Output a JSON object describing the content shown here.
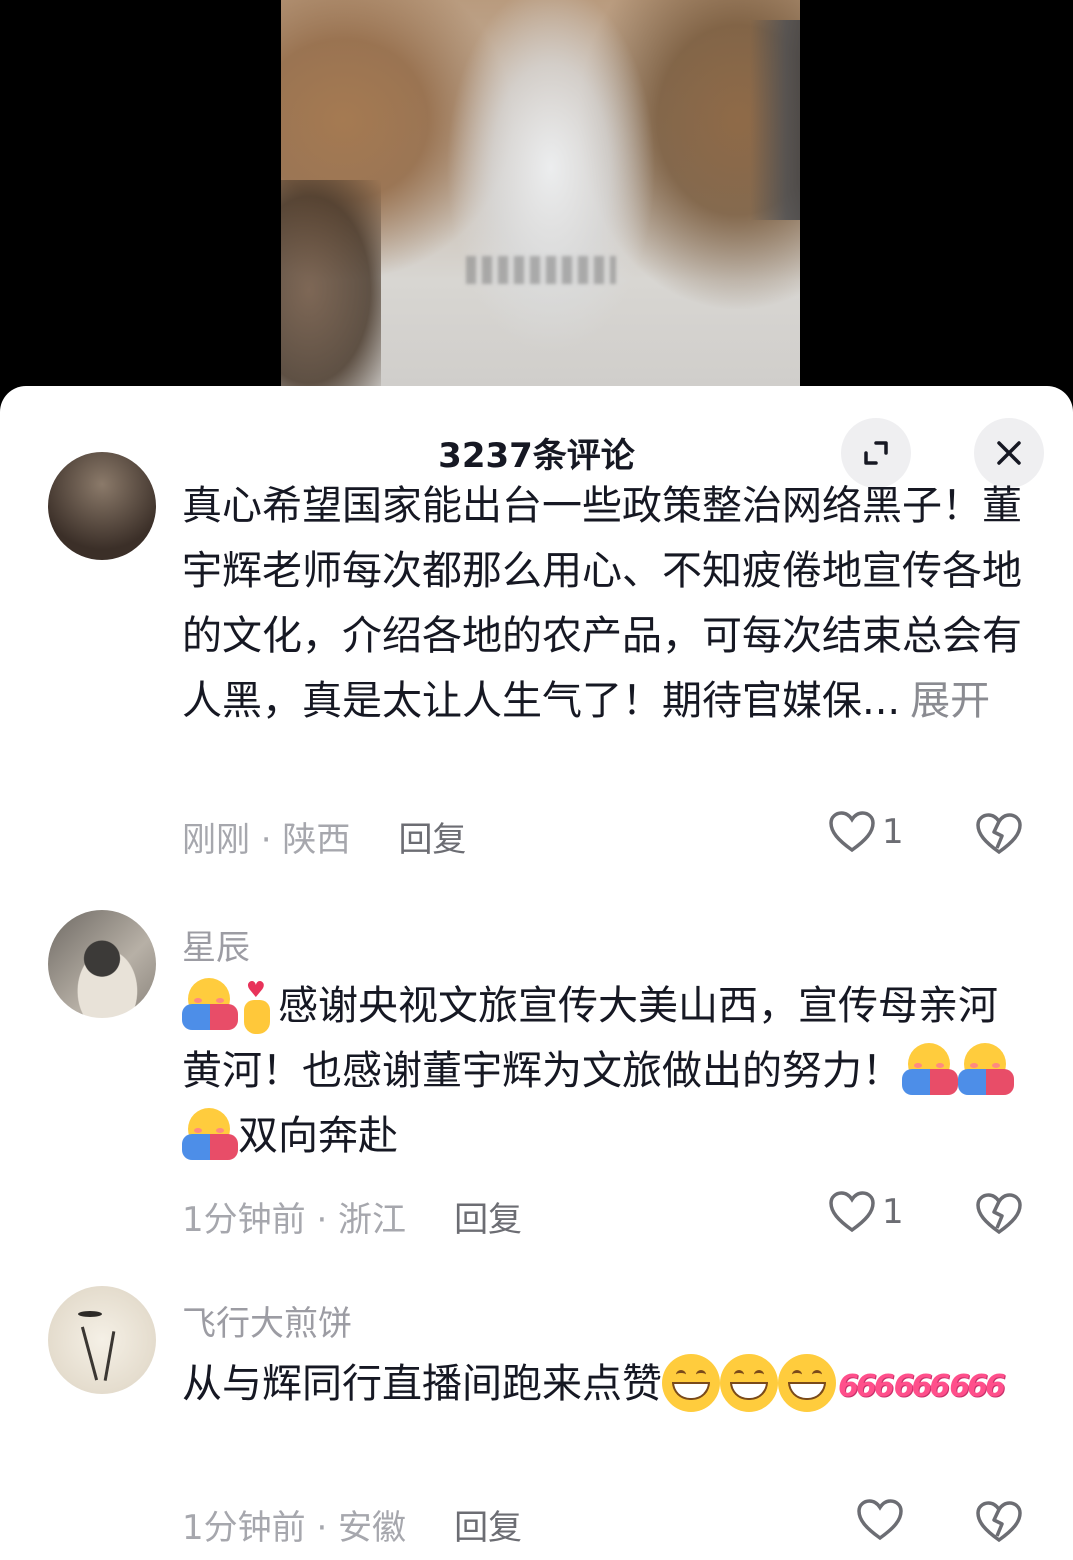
{
  "sheet": {
    "title": "3237条评论"
  },
  "comments": [
    {
      "username": "",
      "text": "真心希望国家能出台一些政策整治网络黑子！董宇辉老师每次都那么用心、不知疲倦地宣传各地的文化，介绍各地的农产品，可每次结束总会有人黑，真是太让人生气了！期待官媒保...",
      "expand_label": "展开",
      "meta": "刚刚 · 陕西",
      "reply_label": "回复",
      "like_count": "1"
    },
    {
      "username": "星辰",
      "text_part1": "感谢央视文旅宣传大美山西，宣传母亲河黄河！也感谢董宇辉为文旅做出的努力！",
      "text_part2": "双向奔赴",
      "meta": "1分钟前 · 浙江",
      "reply_label": "回复",
      "like_count": "1"
    },
    {
      "username": "飞行大煎饼",
      "text": "从与辉同行直播间跑来点赞",
      "sixes": [
        "666",
        "666",
        "666"
      ],
      "meta": "1分钟前 · 安徽",
      "reply_label": "回复",
      "like_count": ""
    }
  ],
  "icons": {
    "expand": "expand-icon",
    "close": "close-icon",
    "like": "heart-outline-icon",
    "dislike": "broken-heart-icon"
  }
}
